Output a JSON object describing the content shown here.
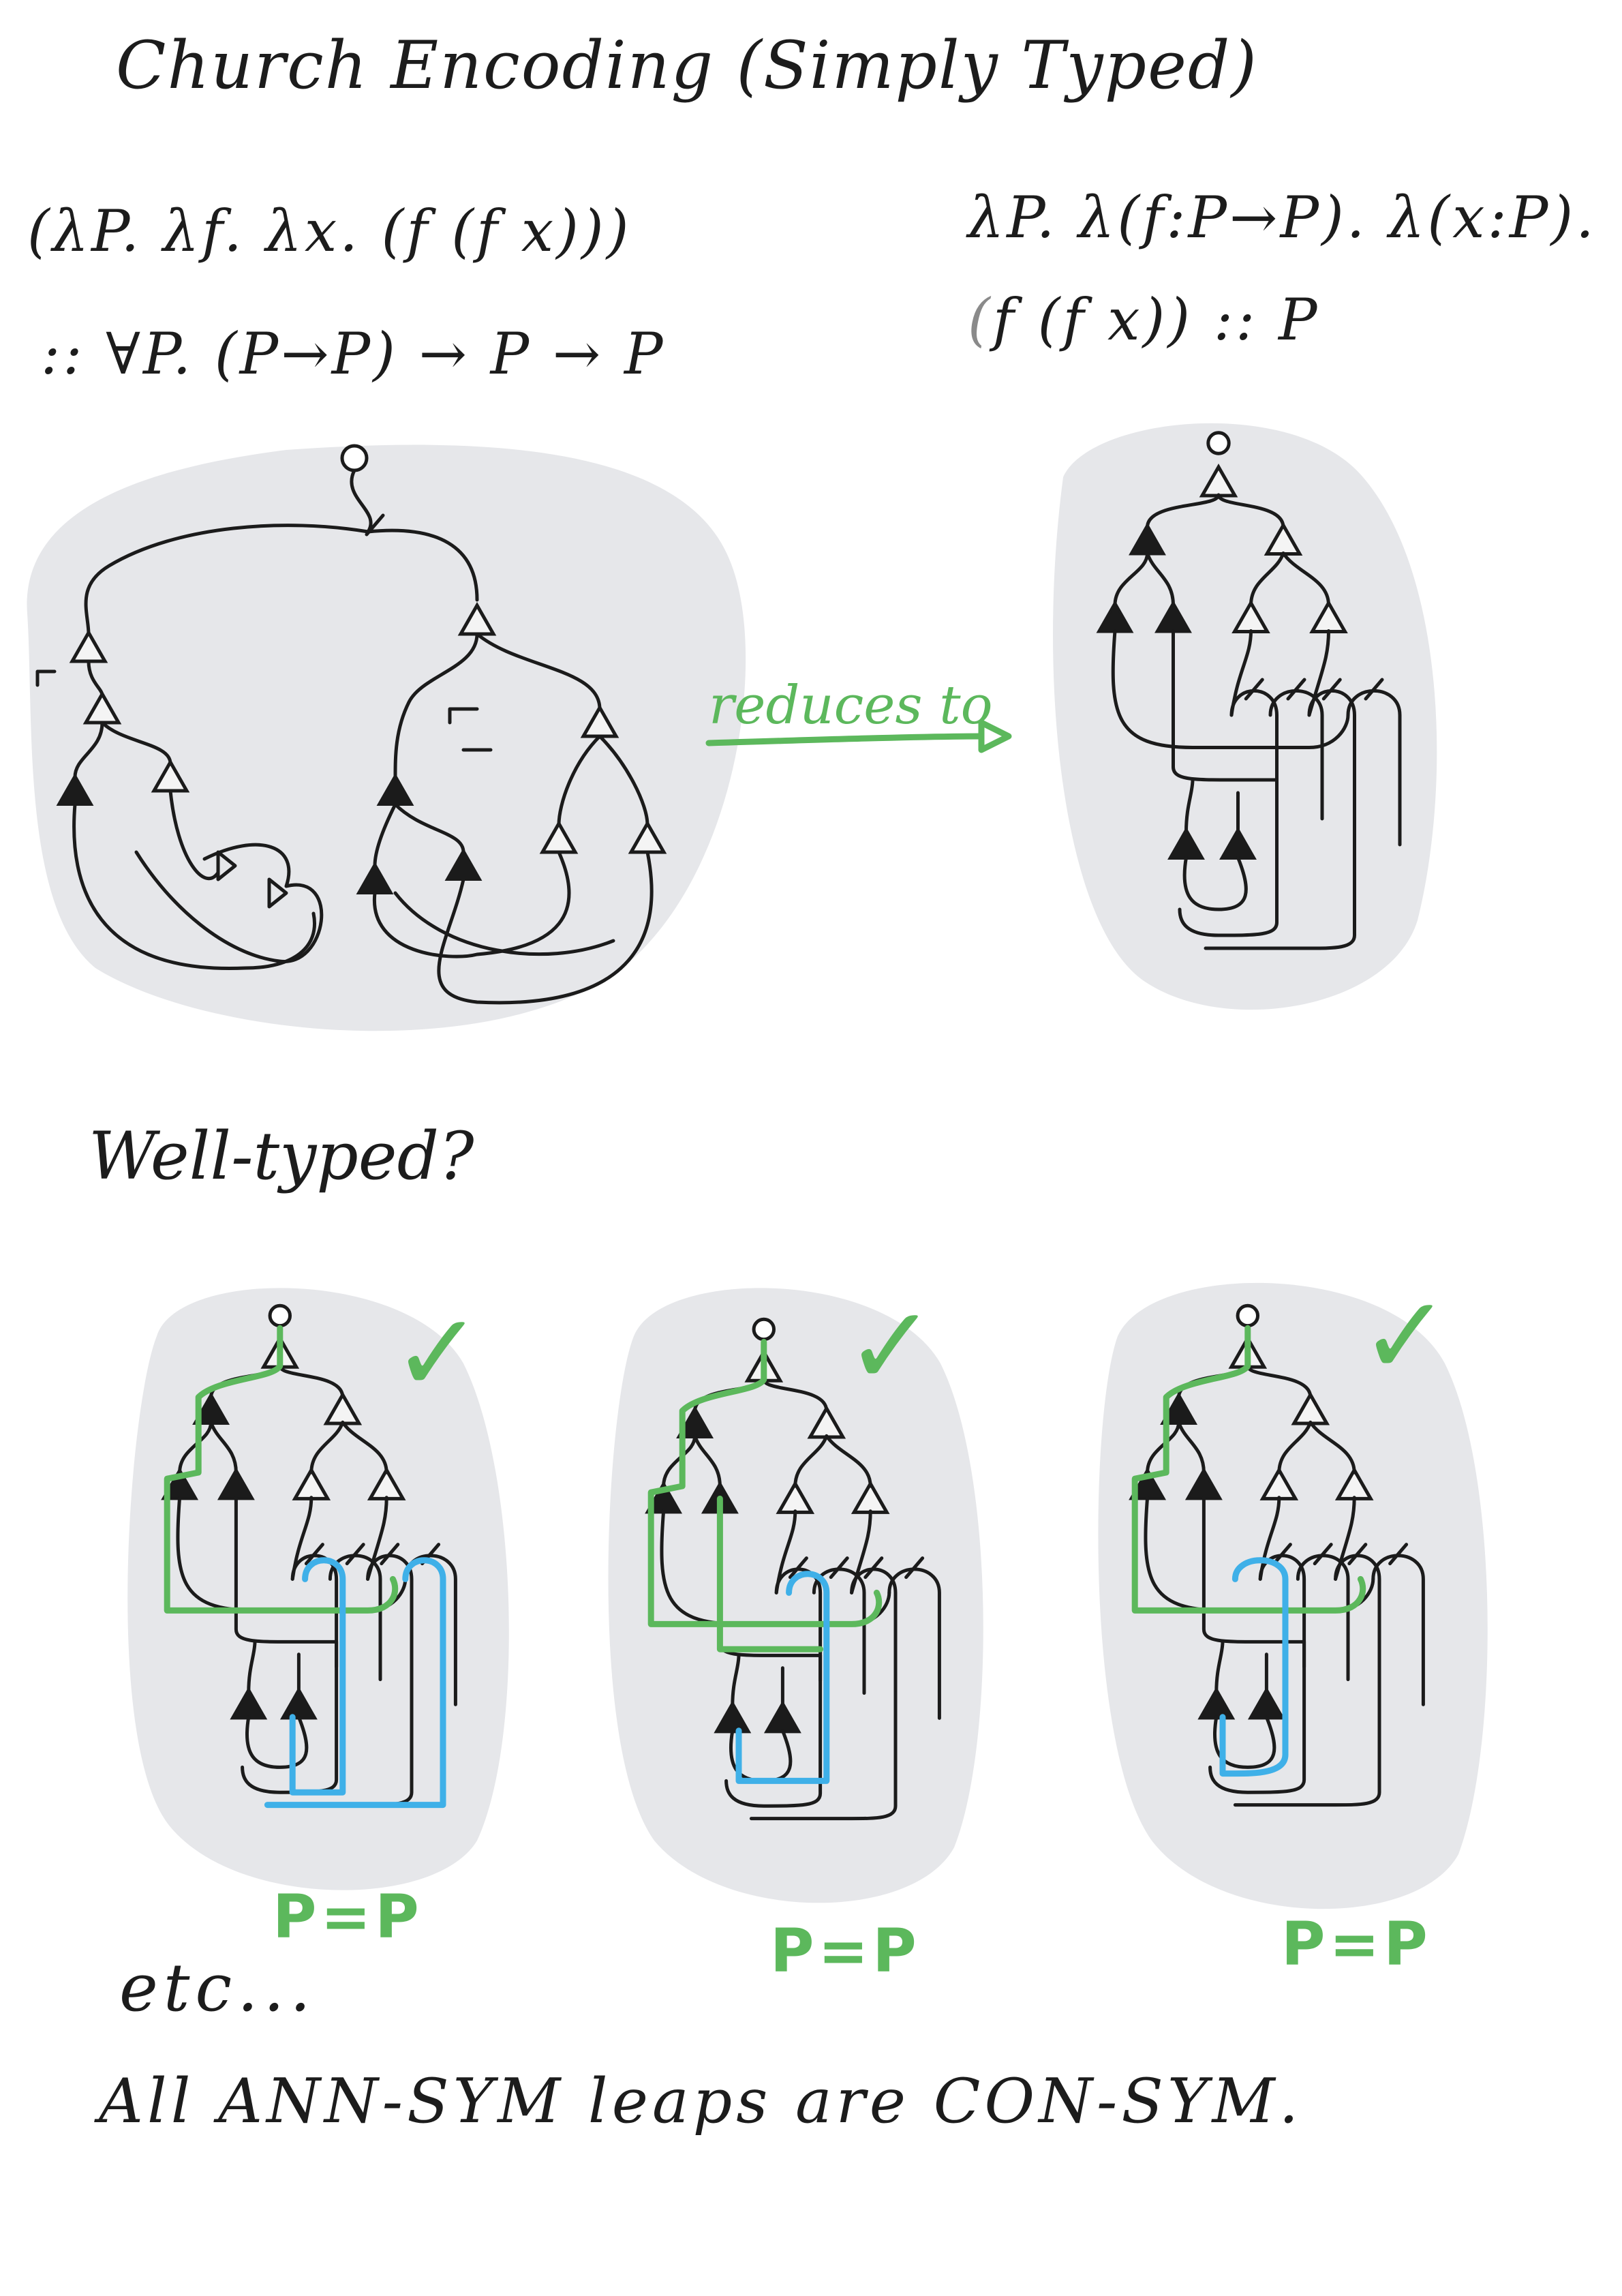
{
  "title": "Church Encoding (Simply Typed)",
  "untyped_term": {
    "line1": "(λP. λf. λx. (f (f x)))",
    "line2": ":: ∀P. (P→P) → P → P"
  },
  "typed_term": {
    "line1": "λP. λ(f:P→P). λ(x:P).",
    "line2_prefix": "(",
    "line2_rest": "f (f x)) :: P"
  },
  "arrow_label": "reduces to",
  "subtitle": "Well-typed?",
  "checks": [
    "✓",
    "✓",
    "✓"
  ],
  "equalities": [
    "P=P",
    "P=P",
    "P=P"
  ],
  "etc": "etc...",
  "statement": "All ANN-SYM leaps are CON-SYM.",
  "colors": {
    "highlight_green": "#5cb85c",
    "highlight_blue": "#3fb0e8",
    "blob_grey": "#e6e7ea",
    "ink": "#1b1b1b"
  }
}
